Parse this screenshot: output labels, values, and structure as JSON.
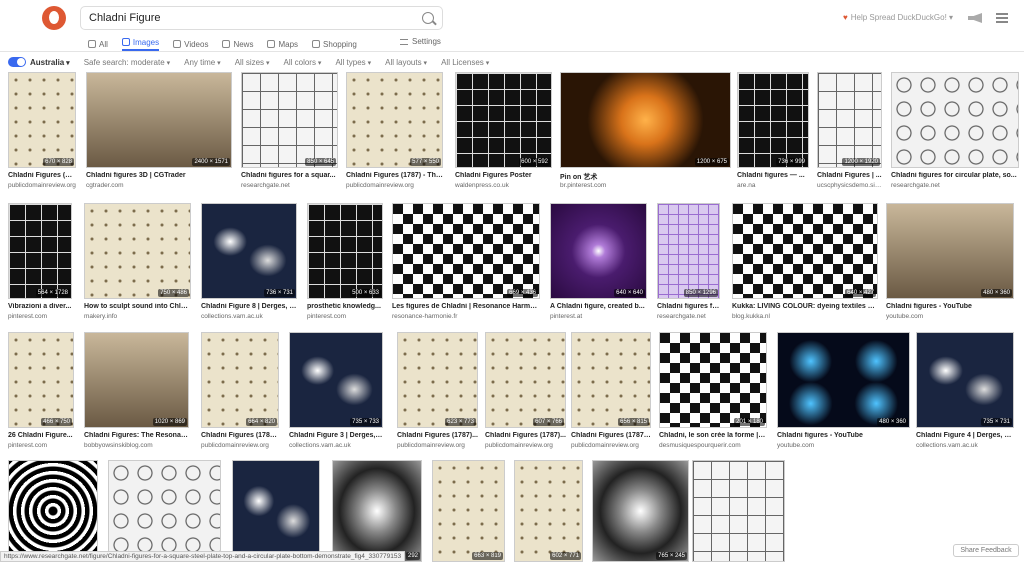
{
  "search": {
    "query": "Chladni Figure"
  },
  "tabs": [
    {
      "label": "All",
      "icon": "search-icon"
    },
    {
      "label": "Images",
      "icon": "image-icon",
      "active": true
    },
    {
      "label": "Videos",
      "icon": "play-icon"
    },
    {
      "label": "News",
      "icon": "newspaper-icon"
    },
    {
      "label": "Maps",
      "icon": "map-pin-icon"
    },
    {
      "label": "Shopping",
      "icon": "shopping-bag-icon"
    }
  ],
  "settings_label": "Settings",
  "spread_label": "Help Spread DuckDuckGo!",
  "filters": {
    "region": "Australia",
    "safe_search": "Safe search: moderate",
    "items": [
      "Any time",
      "All sizes",
      "All colors",
      "All types",
      "All layouts",
      "All Licenses"
    ]
  },
  "results": [
    {
      "title": "Chladni Figures (17...",
      "source": "publicdomainreview.org",
      "dims": "670 × 828",
      "style": "beige"
    },
    {
      "title": "Chladni figures 3D | CGTrader",
      "source": "cgtrader.com",
      "dims": "2400 × 1571",
      "style": "photo"
    },
    {
      "title": "Chladni figures for a squar...",
      "source": "researchgate.net",
      "dims": "850 × 645",
      "style": "grid"
    },
    {
      "title": "Chladni Figures (1787) - The ...",
      "source": "publicdomainreview.org",
      "dims": "577 × 550",
      "style": "beige"
    },
    {
      "title": "Chladni Figures Poster",
      "source": "waldenpress.co.uk",
      "dims": "600 × 592",
      "style": "griddark"
    },
    {
      "title": "Pin on 艺术",
      "source": "br.pinterest.com",
      "dims": "1200 × 675",
      "style": "orange"
    },
    {
      "title": "Chladni figures — ...",
      "source": "are.na",
      "dims": "736 × 999",
      "style": "griddark"
    },
    {
      "title": "Chladni Figures | ...",
      "source": "ucscphysicsdemo.sit...",
      "dims": "1200 × 1920",
      "style": "grid"
    },
    {
      "title": "Chladni figures for circular plate, so...",
      "source": "researchgate.net",
      "dims": "",
      "style": "circles"
    },
    {
      "title": "Vibrazioni a diver...",
      "source": "pinterest.com",
      "dims": "564 × 1728",
      "style": "griddark"
    },
    {
      "title": "How to sculpt sound into Chlad...",
      "source": "makery.info",
      "dims": "750 × 486",
      "style": "beige"
    },
    {
      "title": "Chladni Figure 8 | Derges, S...",
      "source": "collections.vam.ac.uk",
      "dims": "736 × 731",
      "style": "navy"
    },
    {
      "title": "prosthetic knowledg...",
      "source": "pinterest.com",
      "dims": "500 × 633",
      "style": "griddark"
    },
    {
      "title": "Les figures de Chladni | Resonance Harmonie",
      "source": "resonance-harmonie.fr",
      "dims": "669 × 436",
      "style": "ornate"
    },
    {
      "title": "A Chladni figure, created b...",
      "source": "pinterest.at",
      "dims": "640 × 640",
      "style": "purple"
    },
    {
      "title": "Chladni figures fo...",
      "source": "researchgate.net",
      "dims": "850 × 1296",
      "style": "lavender"
    },
    {
      "title": "Kukka: LIVING COLOUR: dyeing textiles wi...",
      "source": "blog.kukka.nl",
      "dims": "640 × 427",
      "style": "ornate"
    },
    {
      "title": "Chladni figures - YouTube",
      "source": "youtube.com",
      "dims": "480 × 360",
      "style": "photo"
    },
    {
      "title": "26 Chladni Figure...",
      "source": "pinterest.com",
      "dims": "466 × 750",
      "style": "beige"
    },
    {
      "title": "Chladni Figures: The Resonanc...",
      "source": "bobbyowsinskiblog.com",
      "dims": "1020 × 869",
      "style": "photo"
    },
    {
      "title": "Chladni Figures (1787)...",
      "source": "publicdomainreview.org",
      "dims": "664 × 820",
      "style": "beige"
    },
    {
      "title": "Chladni Figure 3 | Derges, S...",
      "source": "collections.vam.ac.uk",
      "dims": "735 × 733",
      "style": "navy"
    },
    {
      "title": "Chladni Figures (1787)...",
      "source": "publicdomainreview.org",
      "dims": "623 × 773",
      "style": "beige"
    },
    {
      "title": "Chladni Figures (1787)...",
      "source": "publicdomainreview.org",
      "dims": "607 × 766",
      "style": "beige"
    },
    {
      "title": "Chladni Figures (1787)...",
      "source": "publicdomainreview.org",
      "dims": "656 × 815",
      "style": "beige"
    },
    {
      "title": "Chladni, le son crée la forme | D...",
      "source": "desmusiquespourquerir.com",
      "dims": "201 × 180",
      "style": "ornate"
    },
    {
      "title": "Chladni figures - YouTube",
      "source": "youtube.com",
      "dims": "480 × 360",
      "style": "blue"
    },
    {
      "title": "Chladni Figure 4 | Derges, S...",
      "source": "collections.vam.ac.uk",
      "dims": "735 × 731",
      "style": "navy"
    },
    {
      "title": "",
      "source": "",
      "dims": "",
      "style": "bw"
    },
    {
      "title": "",
      "source": "",
      "dims": "",
      "style": "circles"
    },
    {
      "title": "",
      "source": "",
      "dims": "",
      "style": "navy"
    },
    {
      "title": "",
      "source": "",
      "dims": "292",
      "style": "gray"
    },
    {
      "title": "",
      "source": "",
      "dims": "663 × 819",
      "style": "beige"
    },
    {
      "title": "",
      "source": "",
      "dims": "602 × 771",
      "style": "beige"
    },
    {
      "title": "",
      "source": "",
      "dims": "765 × 245",
      "style": "gray"
    },
    {
      "title": "",
      "source": "",
      "dims": "",
      "style": "grid"
    }
  ],
  "status_url": "https://www.researchgate.net/figure/Chladni-figures-for-a-square-steel-plate-top-and-a-circular-plate-bottom-demonstrate_fig4_330779153",
  "feedback_label": "Share Feedback"
}
